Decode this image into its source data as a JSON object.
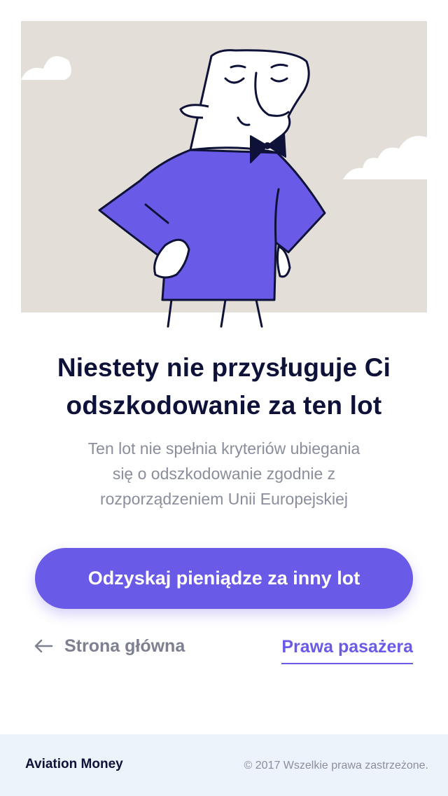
{
  "hero": {
    "illustration": "man-with-bow-tie-illustration",
    "background_color": "#e3dfd8",
    "shirt_color": "#6a5ae8"
  },
  "result": {
    "title_line1": "Niestety nie przysługuje Ci",
    "title_line2": "odszkodowanie za ten lot",
    "desc_line1": "Ten lot nie spełnia kryteriów ubiegania",
    "desc_line2": "się o odszkodowanie zgodnie z",
    "desc_line3": "rozporządzeniem Unii Europejskiej"
  },
  "actions": {
    "primary_label": "Odzyskaj pieniądze za inny lot",
    "home_label": "Strona główna",
    "home_icon": "arrow-left-icon",
    "rights_label": "Prawa pasażera"
  },
  "footer": {
    "brand": "Aviation Money",
    "copyright": "© 2017 Wszelkie prawa zastrzeżone."
  },
  "colors": {
    "accent": "#6a5ae8",
    "text_dark": "#0f1238",
    "text_muted": "#8a8e9c",
    "footer_bg": "#edf3fa"
  }
}
